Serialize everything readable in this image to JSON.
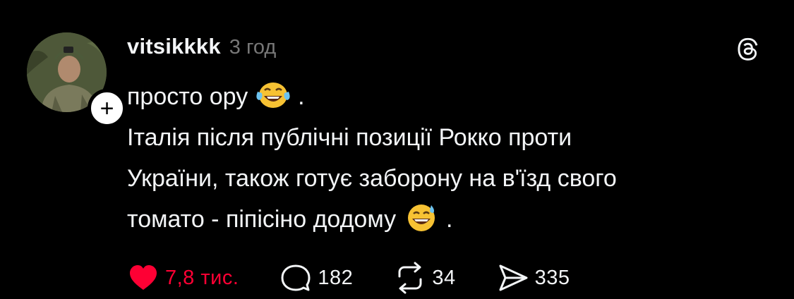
{
  "post": {
    "username": "vitsikkkk",
    "timestamp": "3 год",
    "lines": [
      "просто ору",
      "Італія після публічні позиції Рокко проти",
      "України, також готує заборону на в'їзд свого",
      "томато - піпісіно додому"
    ],
    "line_suffix": ".",
    "emojis": [
      "face-with-tears-of-joy-emoji",
      "grinning-face-with-sweat-emoji"
    ]
  },
  "actions": {
    "likes": "7,8 тис.",
    "replies": "182",
    "reposts": "34",
    "shares": "335"
  },
  "colors": {
    "background": "#000000",
    "text": "#f3f5f7",
    "muted": "#777777",
    "like": "#fe0034"
  },
  "icons": [
    "plus-icon",
    "threads-logo-icon",
    "heart-icon",
    "comment-icon",
    "repost-icon",
    "share-icon"
  ]
}
